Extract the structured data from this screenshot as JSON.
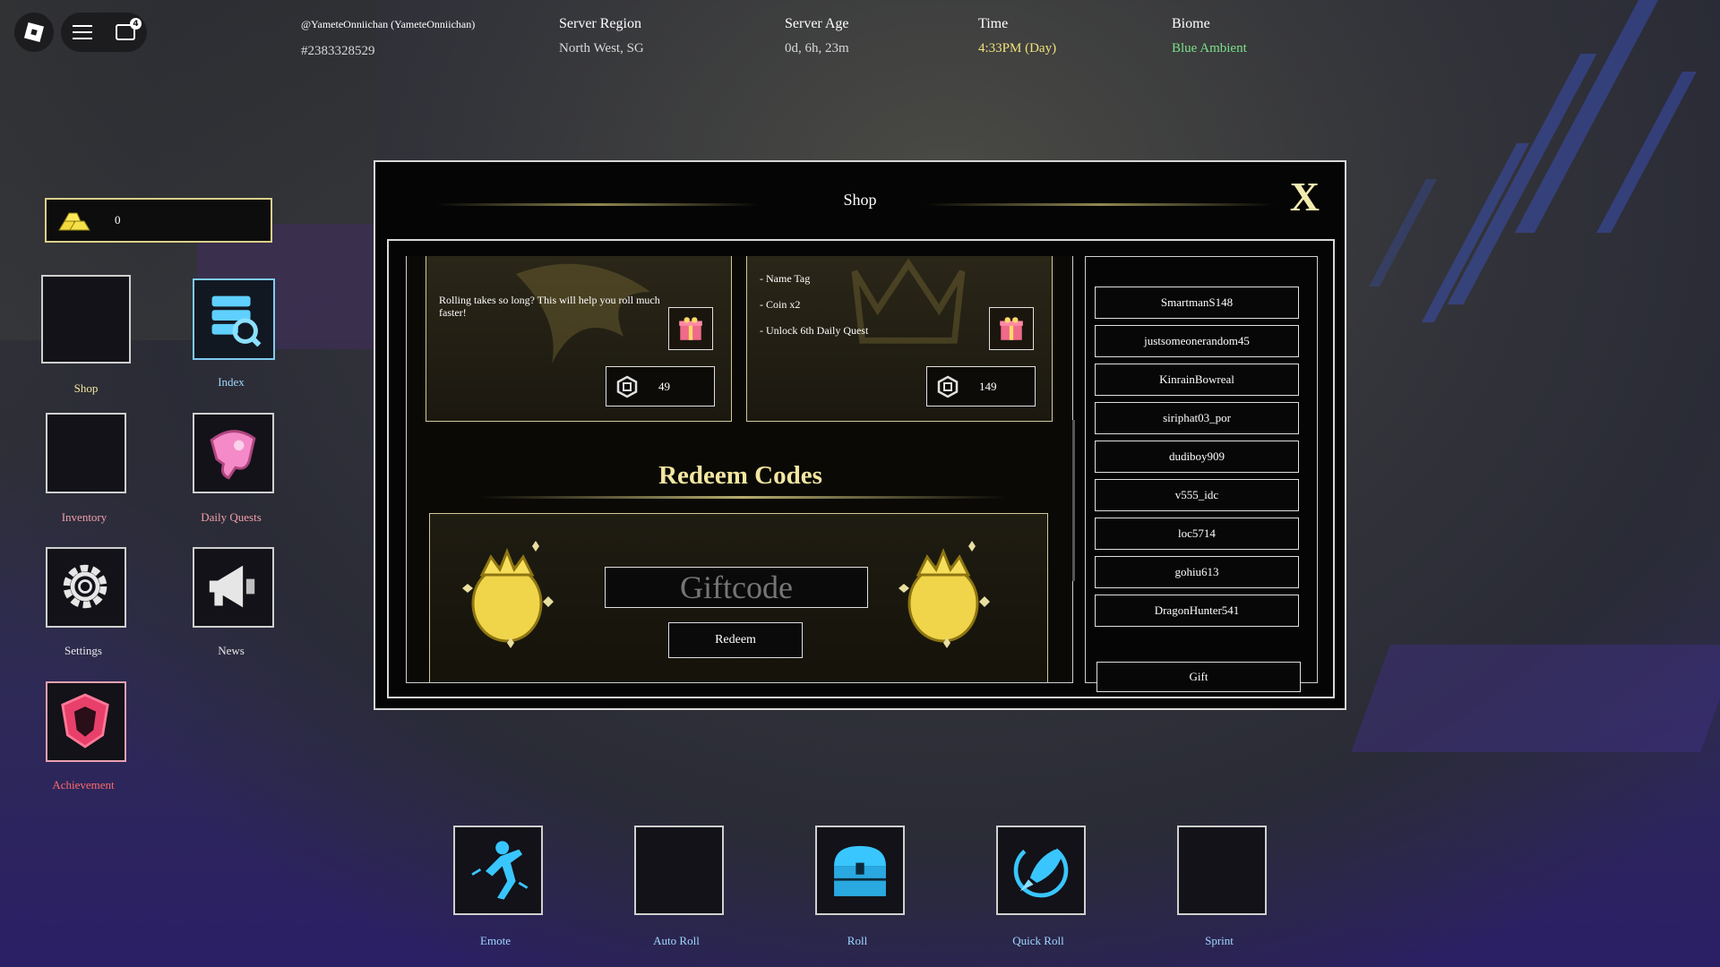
{
  "topbar": {
    "username": "@YameteOnniichan (YameteOnniichan)",
    "server_id": "#2383328529",
    "region_label": "Server Region",
    "region_value": "North West, SG",
    "age_label": "Server Age",
    "age_value": "0d, 6h, 23m",
    "time_label": "Time",
    "time_value": "4:33PM (Day)",
    "biome_label": "Biome",
    "biome_value": "Blue Ambient",
    "notification_count": "4"
  },
  "currency": {
    "amount": "0"
  },
  "sidebar": {
    "shop": "Shop",
    "index": "Index",
    "inventory": "Inventory",
    "daily_quests": "Daily Quests",
    "settings": "Settings",
    "news": "News",
    "achievement": "Achievement"
  },
  "shop": {
    "title": "Shop",
    "close": "X",
    "cards": [
      {
        "description": "Rolling takes so long? This will help you roll much faster!",
        "price": "49"
      },
      {
        "perks": [
          "- Name Tag",
          "- Coin x2",
          "- Unlock 6th Daily Quest"
        ],
        "price": "149"
      }
    ],
    "redeem_title": "Redeem Codes",
    "giftcode_placeholder": "Giftcode",
    "redeem_button": "Redeem",
    "players": [
      "SmartmanS148",
      "justsomeonerandom45",
      "KinrainBowreal",
      "siriphat03_por",
      "dudiboy909",
      "v555_idc",
      "loc5714",
      "gohiu613",
      "DragonHunter541"
    ],
    "gift_button": "Gift"
  },
  "bottom": {
    "emote": "Emote",
    "auto_roll": "Auto Roll",
    "roll": "Roll",
    "quick_roll": "Quick Roll",
    "sprint": "Sprint"
  },
  "colors": {
    "time_value": "#f2e27a",
    "biome_value": "#7ce08a",
    "gold_accent": "#f3e6a0",
    "label_pink": "#f0a0a8",
    "label_blue": "#9fd8ff"
  }
}
